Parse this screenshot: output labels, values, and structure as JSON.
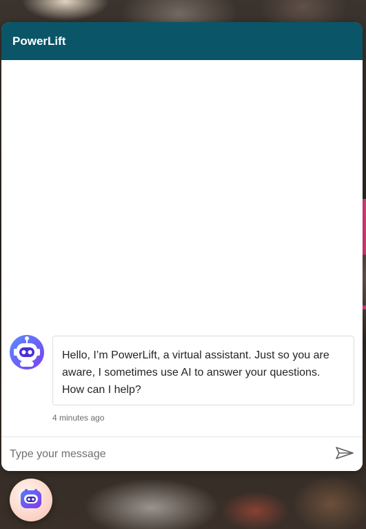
{
  "header": {
    "title": "PowerLift"
  },
  "messages": [
    {
      "sender": "bot",
      "avatar_icon": "robot-avatar-icon",
      "text": "Hello, I’m PowerLift, a virtual assistant. Just so you are aware, I sometimes use AI to answer your questions. How can I help?",
      "timestamp": "4 minutes ago"
    }
  ],
  "composer": {
    "placeholder": "Type your message",
    "value": "",
    "send_icon": "send-icon"
  },
  "launcher": {
    "icon": "robot-launcher-icon"
  },
  "colors": {
    "header_bg": "#0b5568",
    "header_text": "#ffffff",
    "bubble_border": "#dcdcdc",
    "avatar_accent": "#6a3ff0"
  }
}
